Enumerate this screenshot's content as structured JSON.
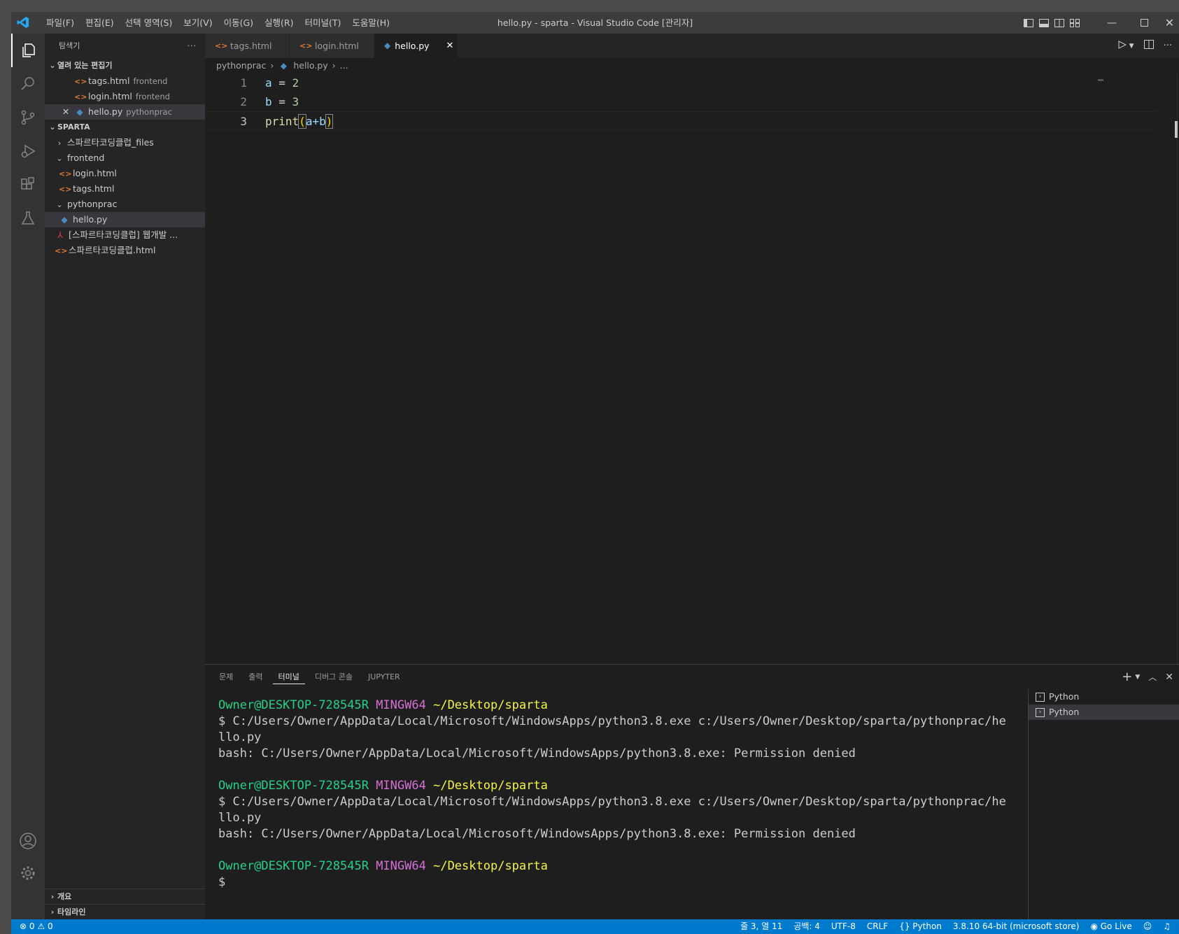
{
  "titlebar": {
    "menu": [
      "파일(F)",
      "편집(E)",
      "선택 영역(S)",
      "보기(V)",
      "이동(G)",
      "실행(R)",
      "터미널(T)",
      "도움말(H)"
    ],
    "title": "hello.py - sparta - Visual Studio Code [관리자]"
  },
  "sidebar": {
    "title": "탐색기",
    "more": "···",
    "open_editors_label": "열려 있는 편집기",
    "open_editors": [
      {
        "name": "tags.html",
        "desc": "frontend"
      },
      {
        "name": "login.html",
        "desc": "frontend"
      },
      {
        "name": "hello.py",
        "desc": "pythonprac"
      }
    ],
    "workspace_label": "SPARTA",
    "tree": {
      "files_folder": "스파르타코딩클럽_files",
      "frontend": "frontend",
      "login": "login.html",
      "tags": "tags.html",
      "pythonprac": "pythonprac",
      "hello": "hello.py",
      "pdf": "[스파르타코딩클럽] 웹개발 ...",
      "html": "스파르타코딩클럽.html"
    },
    "outline": "개요",
    "timeline": "타임라인"
  },
  "tabs": [
    {
      "label": "tags.html"
    },
    {
      "label": "login.html"
    },
    {
      "label": "hello.py"
    }
  ],
  "breadcrumb": {
    "folder": "pythonprac",
    "file": "hello.py",
    "more": "..."
  },
  "editor": {
    "lines": [
      {
        "num": "1"
      },
      {
        "num": "2"
      },
      {
        "num": "3"
      }
    ],
    "code": {
      "a": "a",
      "eq": " = ",
      "two": "2",
      "b": "b",
      "three": "3",
      "print": "print",
      "open": "(",
      "expr": "a+b",
      "close": ")"
    }
  },
  "panel": {
    "tabs": [
      "문제",
      "출력",
      "터미널",
      "디버그 콘솔",
      "JUPYTER"
    ],
    "terminal": {
      "user": "Owner@DESKTOP-728545R",
      "sys": "MINGW64",
      "path": "~/Desktop/sparta",
      "cmd1": "$ C:/Users/Owner/AppData/Local/Microsoft/WindowsApps/python3.8.exe c:/Users/Owner/Desktop/sparta/pythonprac/he",
      "cmd2": "llo.py",
      "err": "bash: C:/Users/Owner/AppData/Local/Microsoft/WindowsApps/python3.8.exe: Permission denied",
      "prompt": "$"
    },
    "terminals": [
      "Python",
      "Python"
    ]
  },
  "status": {
    "errors": "0",
    "warnings": "0",
    "position": "줄 3, 열 11",
    "spaces": "공백: 4",
    "encoding": "UTF-8",
    "eol": "CRLF",
    "language": "Python",
    "interpreter": "3.8.10 64-bit (microsoft store)",
    "golive": "Go Live"
  },
  "colors": {
    "accent": "#007acc",
    "titlebar": "#3c3c3c",
    "editor_bg": "#1e1e1e"
  }
}
